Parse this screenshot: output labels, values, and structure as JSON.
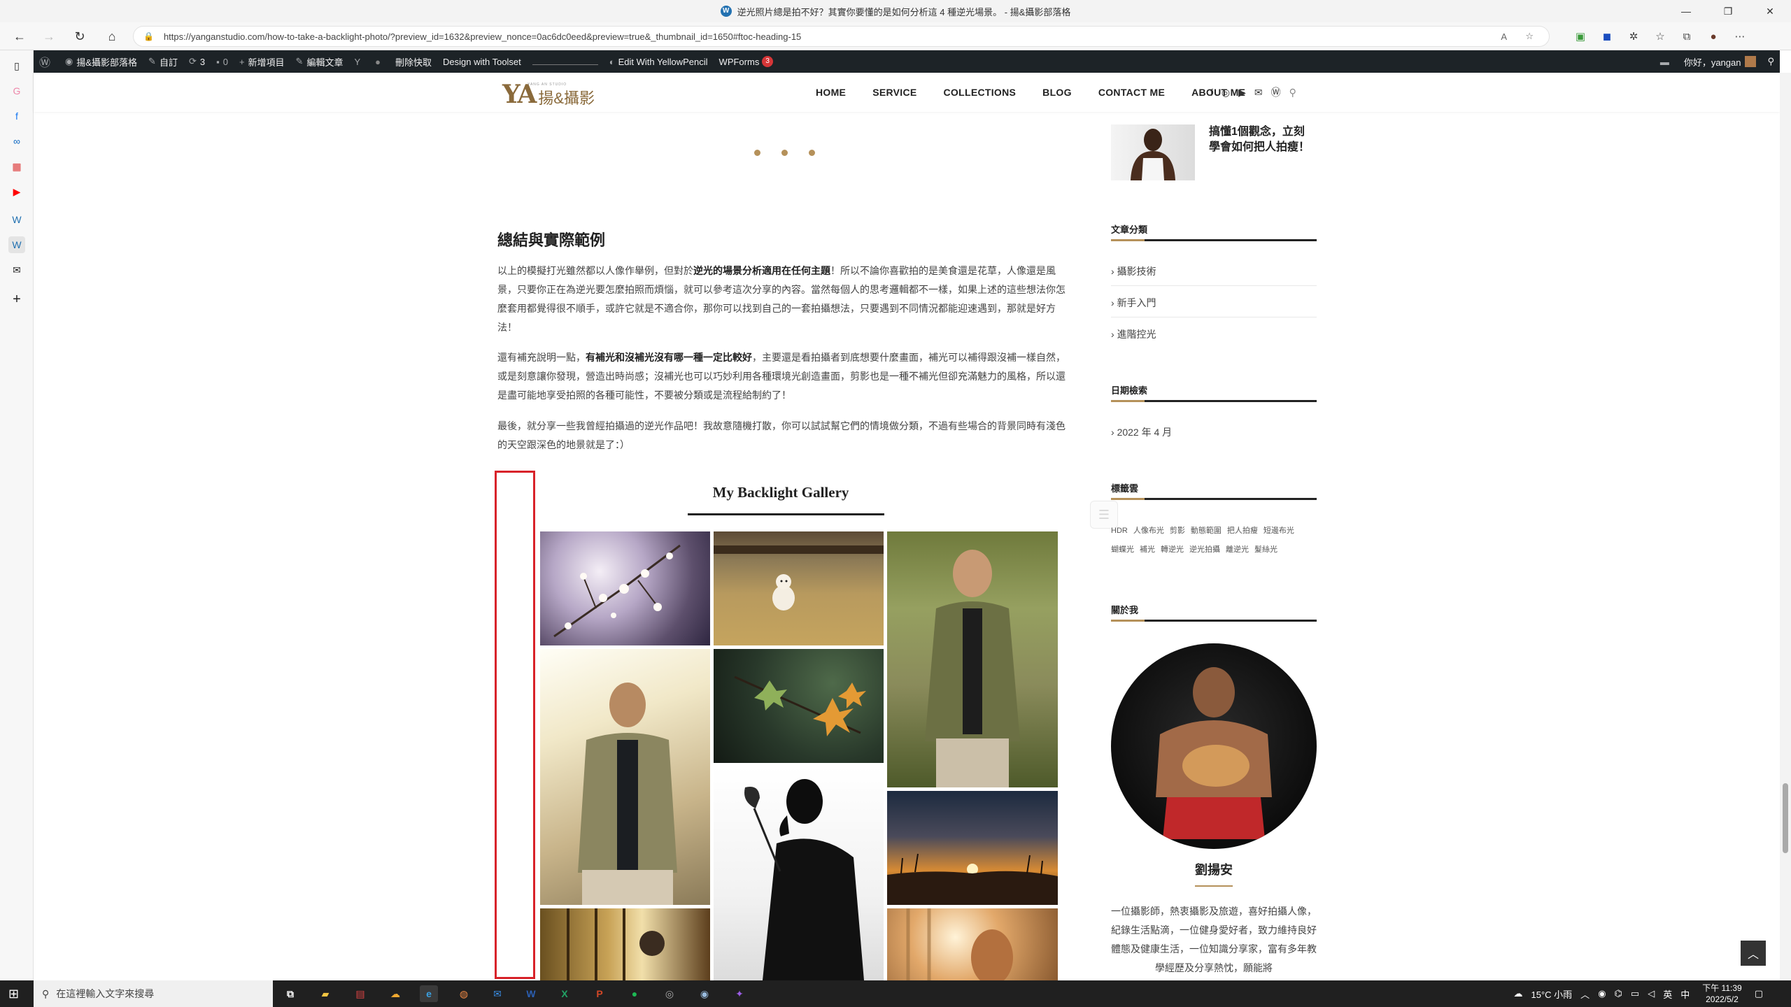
{
  "window": {
    "title": "逆光照片總是拍不好？其實你要懂的是如何分析這 4 種逆光場景。 - 揚&攝影部落格",
    "controls": [
      "—",
      "❐",
      "✕"
    ]
  },
  "browser": {
    "url": "https://yanganstudio.com/how-to-take-a-backlight-photo/?preview_id=1632&preview_nonce=0ac6dc0eed&preview=true&_thumbnail_id=1650#ftoc-heading-15"
  },
  "admin_bar": {
    "site_name": "揚&攝影部落格",
    "customize": "自訂",
    "updates_count": "3",
    "comments_count": "0",
    "new_item": "新增項目",
    "edit_post": "編輯文章",
    "clear_cache": "刪除快取",
    "toolset": "Design with Toolset",
    "yellowpencil": "Edit With YellowPencil",
    "wpforms": "WPForms",
    "wpforms_badge": "3",
    "greeting": "你好，yangan"
  },
  "site": {
    "logo_letters": "YA",
    "logo_cn": "揚&攝影",
    "logo_tiny": "YANG AN STUDIO",
    "menu": [
      "HOME",
      "SERVICE",
      "COLLECTIONS",
      "BLOG",
      "CONTACT ME",
      "ABOUT ME"
    ]
  },
  "article": {
    "heading": "總結與實際範例",
    "p1_a": "以上的模擬打光雖然都以人像作舉例，但對於",
    "p1_b": "逆光的場景分析適用在任何主題",
    "p1_c": "！所以不論你喜歡拍的是美食還是花草，人像還是風景，只要你正在為逆光要怎麼拍照而煩惱，就可以參考這次分享的內容。當然每個人的思考邏輯都不一樣，如果上述的這些想法你怎麼套用都覺得很不順手，或許它就是不適合你，那你可以找到自己的一套拍攝想法，只要遇到不同情況都能迎速遇到，那就是好方法！",
    "p2_a": "還有補充說明一點，",
    "p2_b": "有補光和沒補光沒有哪一種一定比較好",
    "p2_c": "，主要還是看拍攝者到底想要什麼畫面，補光可以補得跟沒補一樣自然，或是刻意讓你發現，營造出時尚感；沒補光也可以巧妙利用各種環境光創造畫面，剪影也是一種不補光但卻充滿魅力的風格，所以還是盡可能地享受拍照的各種可能性，不要被分類或是流程給制約了！",
    "p3": "最後，就分享一些我曾經拍攝過的逆光作品吧！我故意隨機打散，你可以試試幫它們的情境做分類，不過有些場合的背景同時有淺色的天空跟深色的地景就是了：）",
    "gallery_title": "My Backlight Gallery"
  },
  "widgets": {
    "recent_post_title": "搞懂1個觀念，立刻學會如何把人拍瘦！",
    "categories_title": "文章分類",
    "categories": [
      "攝影技術",
      "新手入門",
      "進階控光"
    ],
    "archives_title": "日期檢索",
    "archives": [
      "2022 年 4 月"
    ],
    "tags_title": "標籤雲",
    "tags": [
      "HDR",
      "人像布光",
      "剪影",
      "動態範圍",
      "把人拍瘦",
      "短邊布光",
      "蝴蝶光",
      "補光",
      "轉逆光",
      "逆光拍攝",
      "離逆光",
      "髮絲光"
    ],
    "about_title": "關於我",
    "about_name": "劉揚安",
    "about_text": "一位攝影師，熱衷攝影及旅遊，喜好拍攝人像，紀錄生活點滴，一位健身愛好者，致力維持良好體態及健康生活，一位知識分享家，富有多年教學經歷及分享熱忱，願能將"
  },
  "taskbar": {
    "search_placeholder": "在這裡輸入文字來搜尋",
    "weather": "15°C 小雨",
    "lang": "英",
    "time": "下午 11:39",
    "date": "2022/5/2"
  },
  "colors": {
    "accent_gold": "#b5915a",
    "admin_bar": "#1d2327",
    "highlight_red": "#d8232a"
  }
}
